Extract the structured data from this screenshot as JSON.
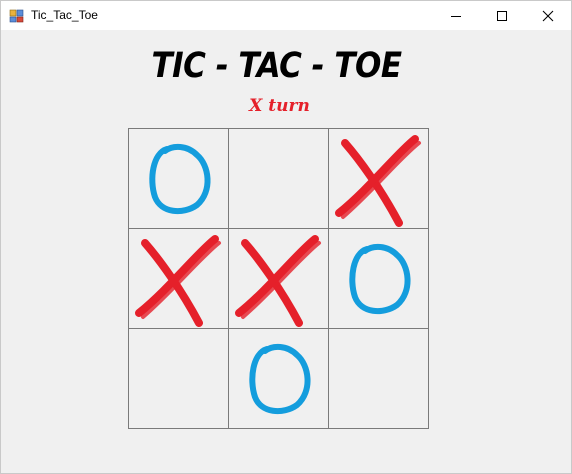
{
  "window": {
    "title": "Tic_Tac_Toe",
    "icon": "app-icon"
  },
  "game": {
    "title": "TIC - TAC - TOE",
    "turn_text": "X turn",
    "x_color": "#e5202a",
    "o_color": "#149ddd",
    "board": [
      [
        "O",
        "",
        "X"
      ],
      [
        "X",
        "X",
        "O"
      ],
      [
        "",
        "O",
        ""
      ]
    ]
  }
}
